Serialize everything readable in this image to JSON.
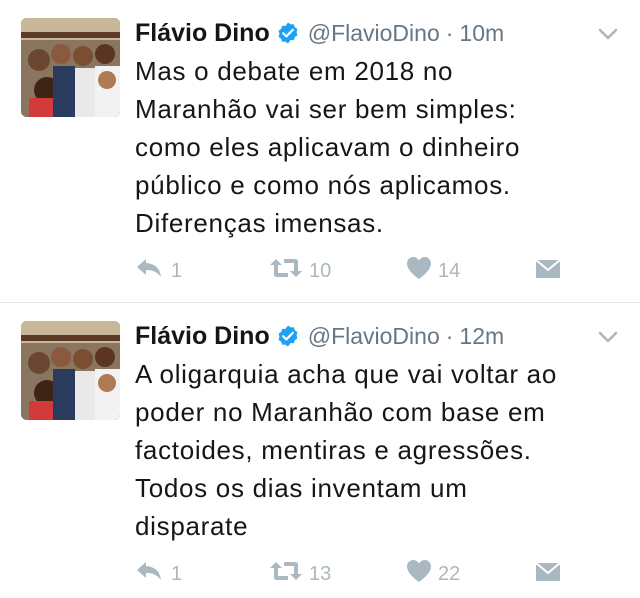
{
  "tweets": [
    {
      "author_name": "Flávio Dino",
      "handle": "@FlavioDino",
      "separator": "·",
      "time": "10m",
      "text": "Mas o debate em 2018 no\nMaranhão vai ser bem simples:\ncomo eles aplicavam o dinheiro\npúblico e como nós aplicamos.\nDiferenças imensas.",
      "replies": "1",
      "retweets": "10",
      "likes": "14"
    },
    {
      "author_name": "Flávio Dino",
      "handle": "@FlavioDino",
      "separator": "·",
      "time": "12m",
      "text": "A oligarquia acha que vai voltar ao\npoder no Maranhão com base em\nfactoides, mentiras e agressões.\nTodos os dias inventam um\ndisparate",
      "replies": "1",
      "retweets": "13",
      "likes": "22"
    }
  ],
  "colors": {
    "verified": "#1da1f2",
    "meta": "#657786",
    "action_icon": "#aab8c2",
    "divider": "#e1e8ed"
  },
  "icons": {
    "verified": "verified-badge-icon",
    "caret": "chevron-down-icon",
    "reply": "reply-icon",
    "retweet": "retweet-icon",
    "like": "heart-icon",
    "dm": "envelope-icon"
  }
}
